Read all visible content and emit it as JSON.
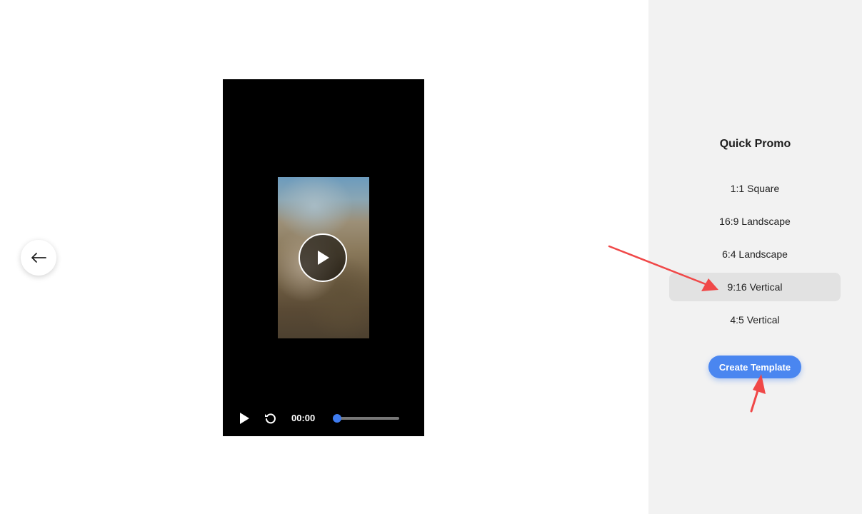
{
  "player": {
    "time": "00:00",
    "progress": 0.05,
    "icons": {
      "big_play": "play-circle-icon",
      "play": "play-icon",
      "replay": "replay-icon"
    }
  },
  "navigation": {
    "back_icon": "arrow-left-icon"
  },
  "panel": {
    "title": "Quick Promo",
    "options": [
      {
        "label": "1:1 Square",
        "selected": false
      },
      {
        "label": "16:9 Landscape",
        "selected": false
      },
      {
        "label": "6:4 Landscape",
        "selected": false
      },
      {
        "label": "9:16 Vertical",
        "selected": true
      },
      {
        "label": "4:5 Vertical",
        "selected": false
      }
    ],
    "create_label": "Create Template"
  },
  "colors": {
    "accent": "#4a86f0",
    "annotation": "#f04848",
    "panel_bg": "#f2f2f2",
    "selected_bg": "#e2e2e2",
    "player_bg": "#000000"
  }
}
